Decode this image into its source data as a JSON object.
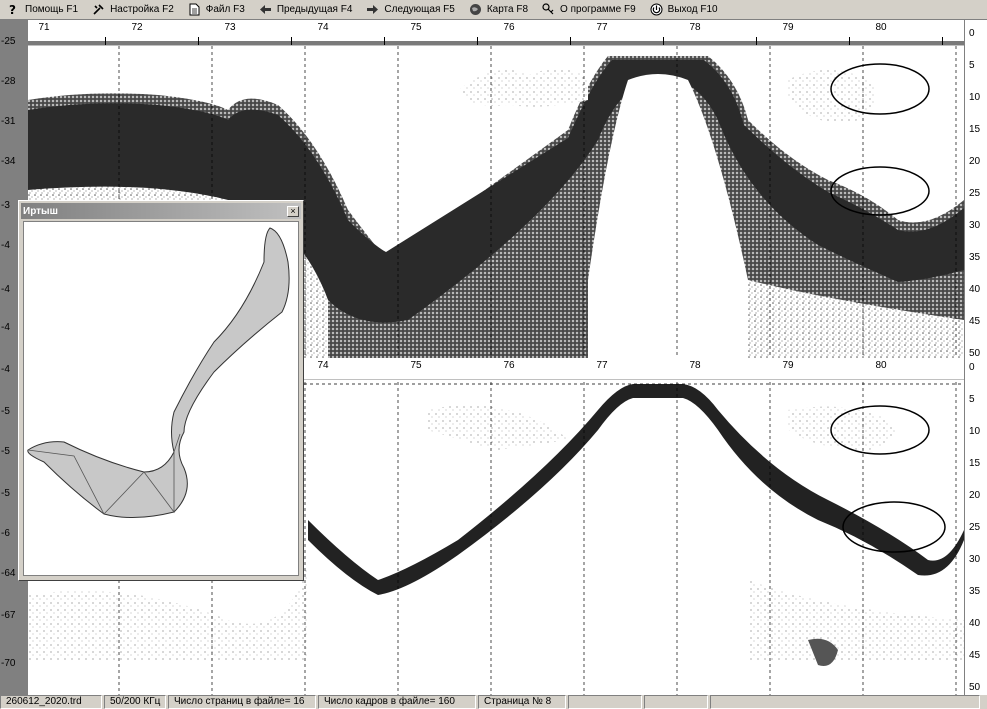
{
  "menu": [
    {
      "label": "Помощь F1",
      "icon": "help-icon"
    },
    {
      "label": "Настройка F2",
      "icon": "settings-icon"
    },
    {
      "label": "Файл F3",
      "icon": "file-icon"
    },
    {
      "label": "Предыдущая F4",
      "icon": "arrow-left-icon"
    },
    {
      "label": "Следующая F5",
      "icon": "arrow-right-icon"
    },
    {
      "label": "Карта F8",
      "icon": "globe-icon"
    },
    {
      "label": "О программе F9",
      "icon": "key-icon"
    },
    {
      "label": "Выход F10",
      "icon": "exit-icon"
    }
  ],
  "ruler_labels": [
    "71",
    "72",
    "73",
    "74",
    "75",
    "76",
    "77",
    "78",
    "79",
    "80"
  ],
  "lower_ruler_labels": [
    "74",
    "75",
    "76",
    "77",
    "78",
    "79",
    "80"
  ],
  "left_scale": [
    "-25",
    "-28",
    "-31",
    "-34",
    "-3",
    "-4",
    "-4",
    "-4",
    "-4",
    "-5",
    "-5",
    "-5",
    "-6",
    "-64",
    "-67",
    "-70"
  ],
  "right_scale_upper": [
    "0",
    "5",
    "10",
    "15",
    "20",
    "25",
    "30",
    "35",
    "40",
    "45",
    "50"
  ],
  "right_scale_lower": [
    "0",
    "5",
    "10",
    "15",
    "20",
    "25",
    "30",
    "35",
    "40",
    "45",
    "50"
  ],
  "map_window": {
    "title": "Иртыш",
    "close": "×"
  },
  "status": [
    "260612_2020.trd",
    "50/200 КГц",
    "Число страниц в файле= 16",
    "Число кадров в файле= 160",
    "Страница № 8",
    "",
    "",
    ""
  ],
  "colors": {
    "echo_dark": "#2a2a2a",
    "echo_mid": "#5a5a5a",
    "lake_fill": "#c8c8c8",
    "chrome": "#d4d0c8"
  }
}
